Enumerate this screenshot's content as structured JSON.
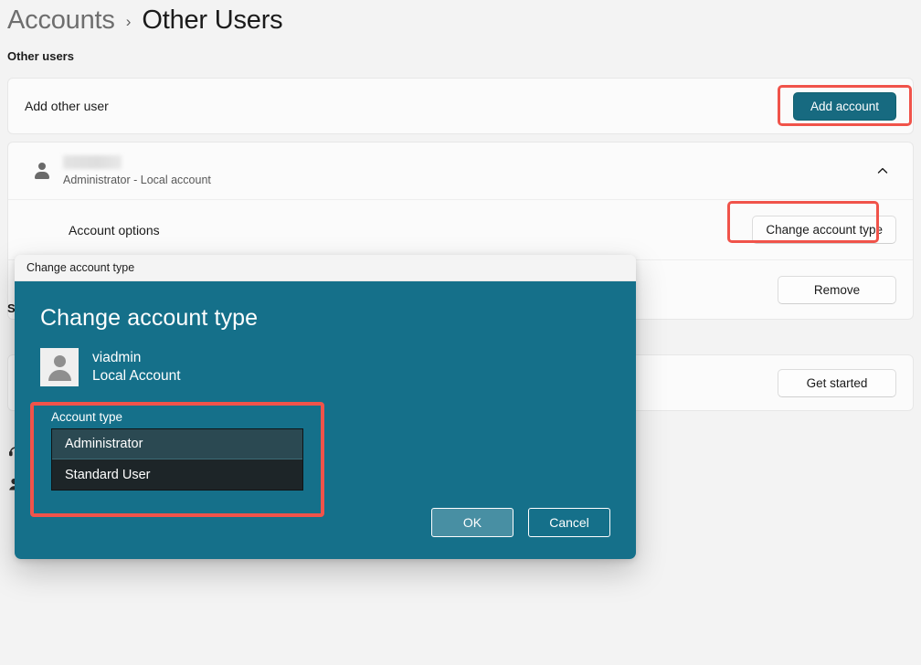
{
  "breadcrumb": {
    "parent": "Accounts",
    "separator": "›",
    "current": "Other Users"
  },
  "page": {
    "section_label": "Other users",
    "hidden_section_heading": "Set up a kiosk"
  },
  "add_other_user": {
    "label": "Add other user",
    "button": "Add account"
  },
  "account": {
    "name_redacted": "",
    "subtitle": "Administrator - Local account",
    "expand_icon": "chevron-up-icon",
    "options_label": "Account options",
    "change_type_button": "Change account type",
    "remove_button": "Remove"
  },
  "kiosk": {
    "button": "Get started"
  },
  "dialog": {
    "titlebar": "Change account type",
    "heading": "Change account type",
    "user": {
      "name": "viadmin",
      "type": "Local Account"
    },
    "account_type_label": "Account type",
    "options": [
      {
        "label": "Administrator",
        "selected": true
      },
      {
        "label": "Standard User",
        "selected": false
      }
    ],
    "ok_button": "OK",
    "cancel_button": "Cancel"
  },
  "sidebar_icon_stubs": [
    {
      "name": "support-icon"
    },
    {
      "name": "accounts-icon"
    }
  ],
  "colors": {
    "accent_teal": "#176a80",
    "dialog_teal": "#15708a",
    "annotation_red": "#f0534a",
    "page_background": "#f3f3f3",
    "card_background": "#fbfbfb",
    "combo_background": "#1d2528",
    "combo_selected": "#2b4952"
  }
}
